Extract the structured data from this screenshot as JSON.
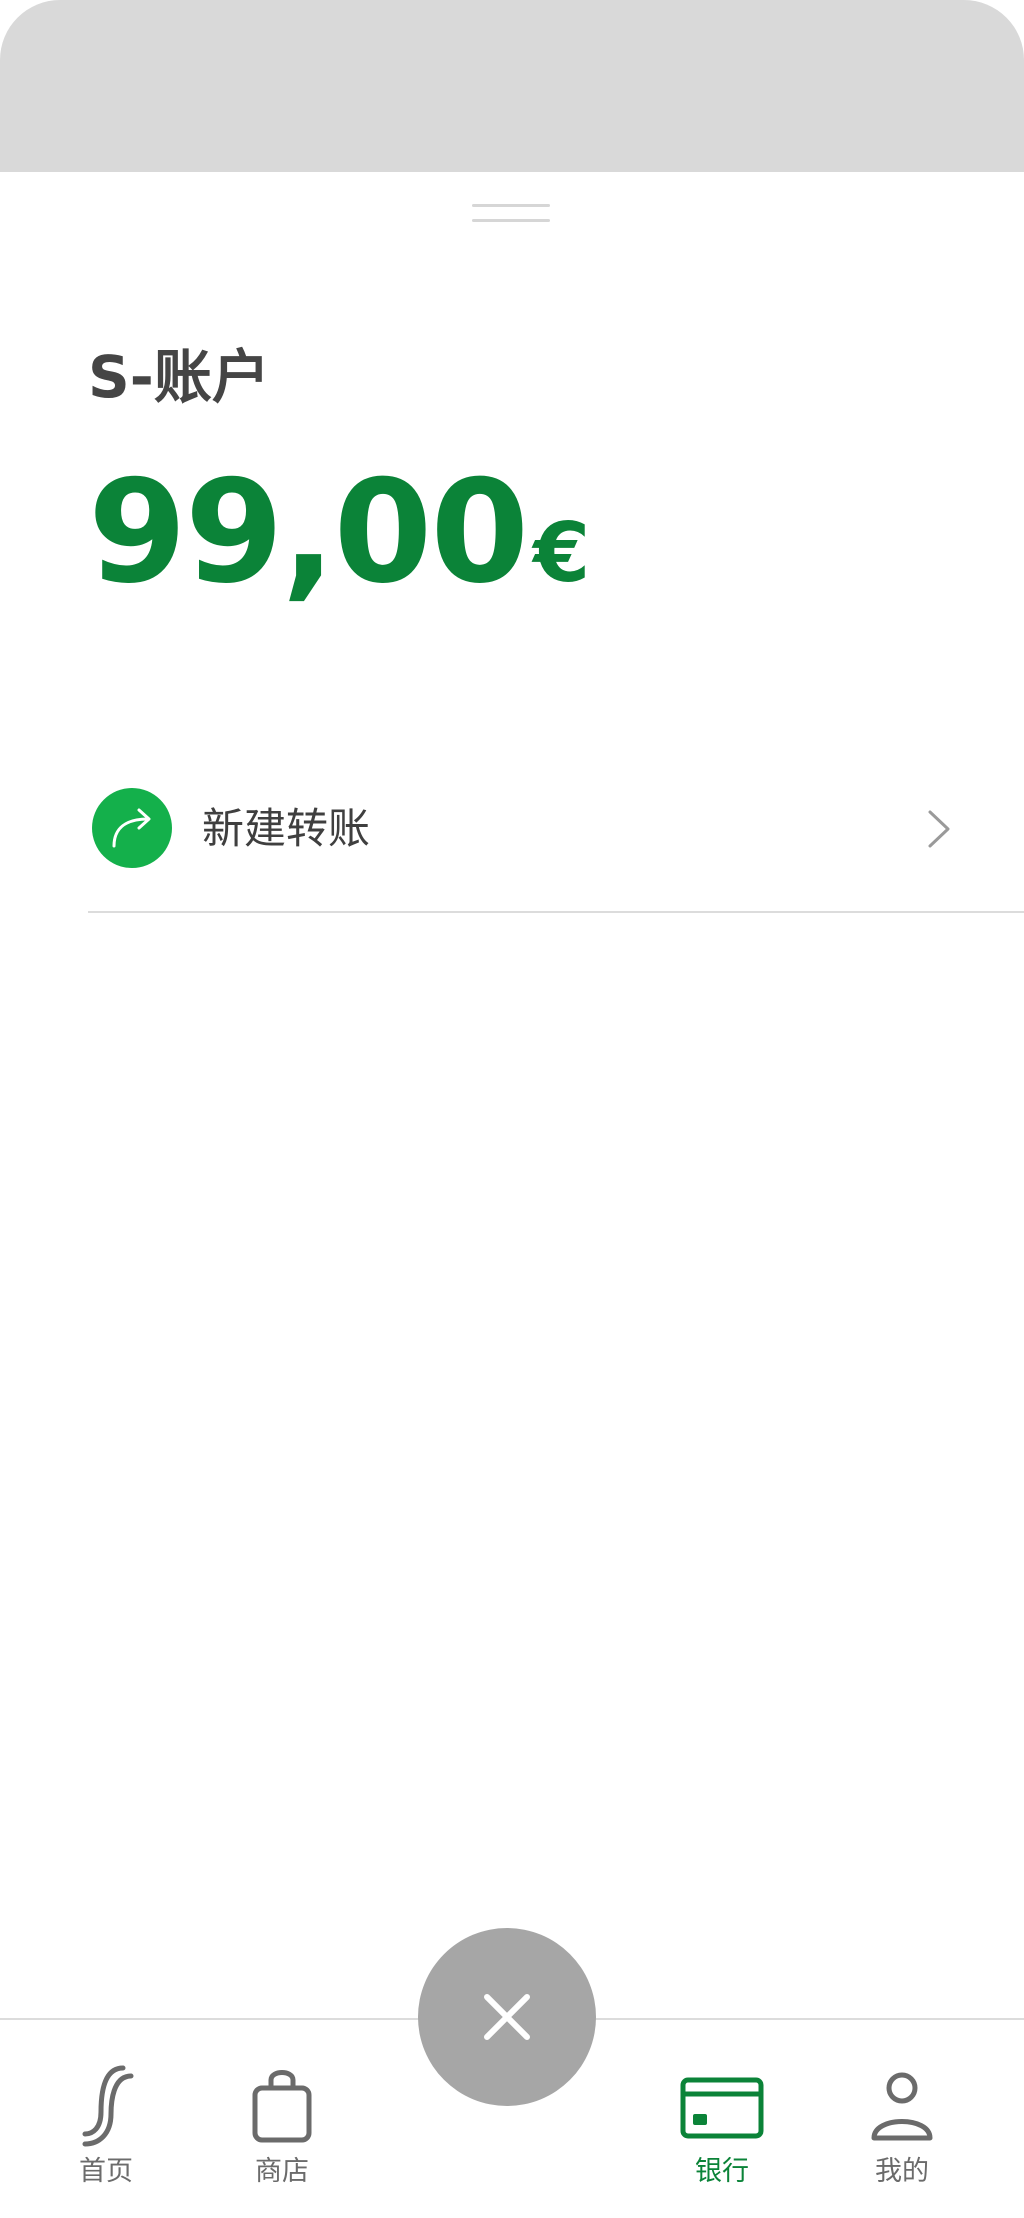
{
  "account": {
    "title": "S-账户",
    "balance_amount": "99,00",
    "balance_currency": "€"
  },
  "actions": [
    {
      "label": "新建转账",
      "icon": "arrow-forward-icon"
    }
  ],
  "bottom_nav": {
    "items": [
      {
        "label": "首页",
        "icon": "s-logo-icon",
        "active": false
      },
      {
        "label": "商店",
        "icon": "shopping-bag-icon",
        "active": false
      },
      {
        "label": "银行",
        "icon": "card-icon",
        "active": true
      },
      {
        "label": "我的",
        "icon": "person-icon",
        "active": false
      }
    ]
  },
  "fab": {
    "icon": "close-icon"
  },
  "colors": {
    "brand_green": "#0b8338",
    "icon_green": "#14b04b",
    "top_card_gray": "#d9d9d9",
    "fab_gray": "#a6a6a6",
    "nav_gray": "#6b6b6b"
  }
}
